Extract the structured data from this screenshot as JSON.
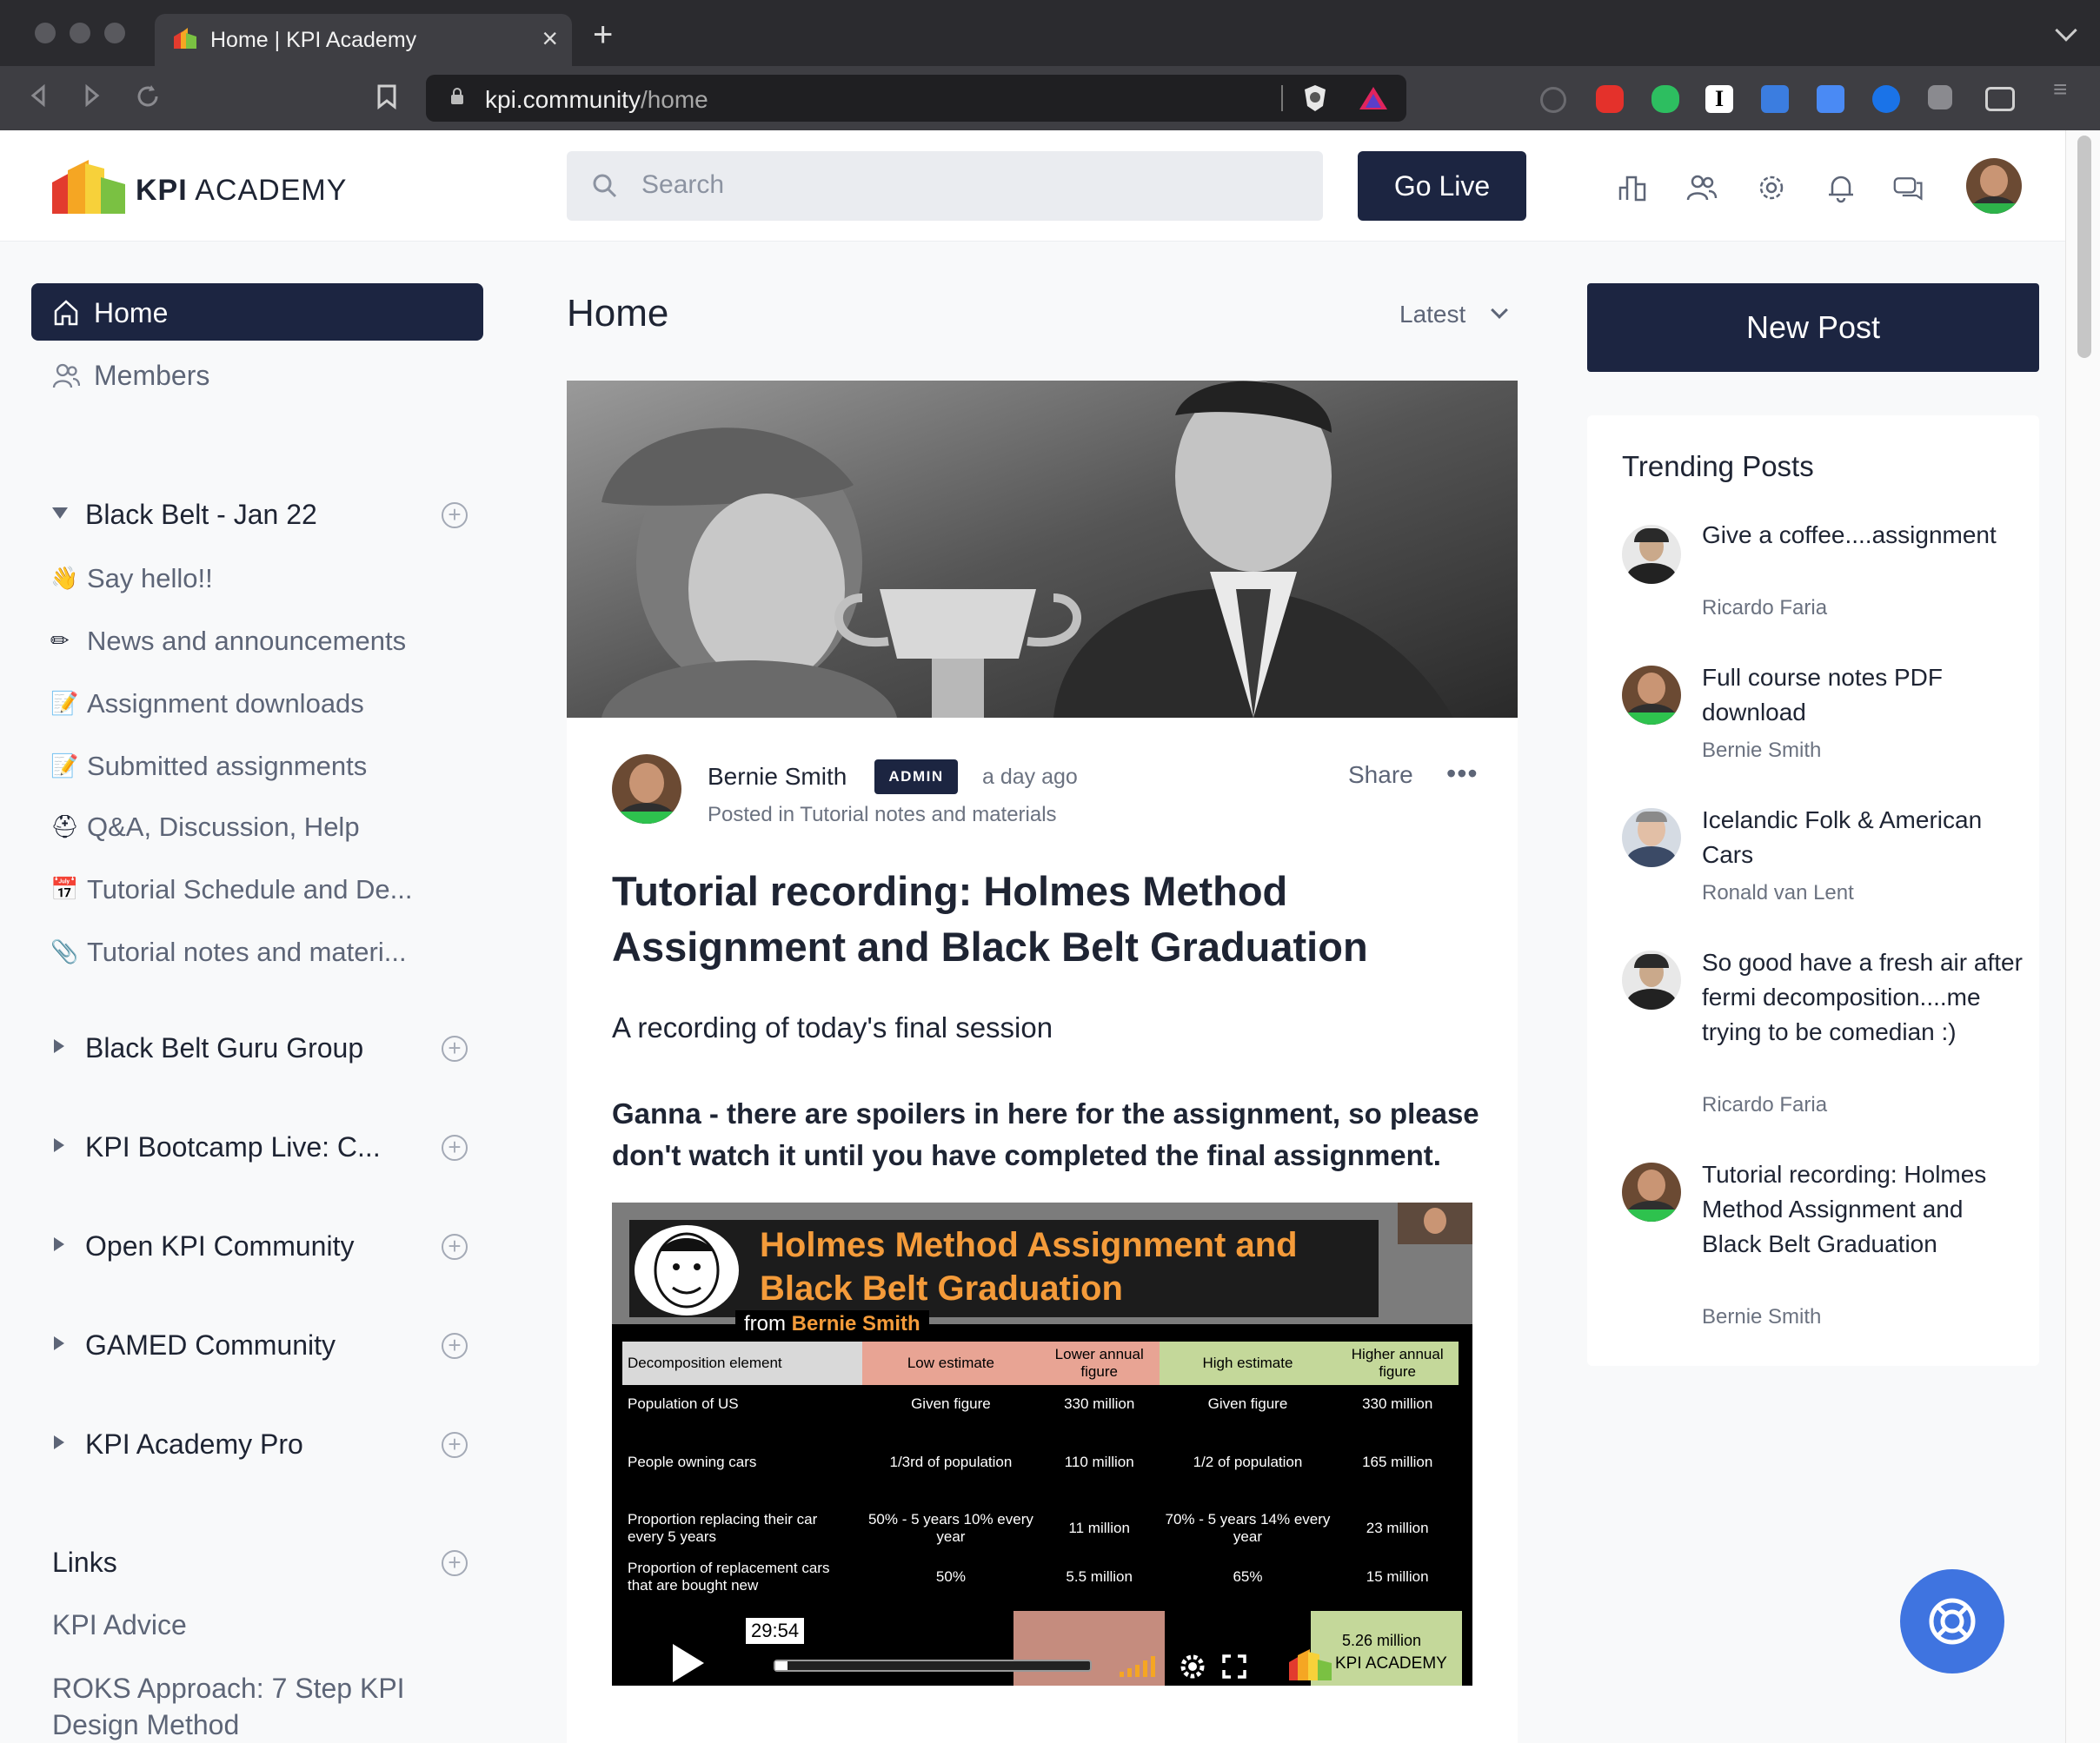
{
  "browser": {
    "tab_title": "Home | KPI Academy",
    "url_domain": "kpi.community",
    "url_path": "/home"
  },
  "header": {
    "logo_bold": "KPI",
    "logo_text": " ACADEMY",
    "search_placeholder": "Search",
    "go_live": "Go Live",
    "icons": [
      "leaderboard-icon",
      "members-icon",
      "settings-icon",
      "bell-icon",
      "chat-icon"
    ]
  },
  "sidebar": {
    "home": "Home",
    "members": "Members",
    "space_groups": [
      {
        "label": "Black Belt - Jan 22",
        "expanded": true
      },
      {
        "label": "Black Belt Guru Group",
        "expanded": false
      },
      {
        "label": "KPI Bootcamp Live: C...",
        "expanded": false
      },
      {
        "label": "Open KPI Community",
        "expanded": false
      },
      {
        "label": "GAMED Community",
        "expanded": false
      },
      {
        "label": "KPI Academy Pro",
        "expanded": false
      }
    ],
    "spaces": [
      {
        "emoji": "👋",
        "label": "Say hello!!"
      },
      {
        "emoji": "✏",
        "label": "News and announcements"
      },
      {
        "emoji": "📝",
        "label": "Assignment downloads"
      },
      {
        "emoji": "📝",
        "label": "Submitted assignments"
      },
      {
        "emoji": "⛑",
        "label": "Q&A, Discussion, Help"
      },
      {
        "emoji": "📅",
        "label": "Tutorial Schedule and De..."
      },
      {
        "emoji": "📎",
        "label": "Tutorial notes and materi..."
      }
    ],
    "links_title": "Links",
    "links": [
      "KPI Advice",
      "ROKS Approach: 7 Step KPI Design Method"
    ]
  },
  "feed": {
    "title": "Home",
    "sort": "Latest",
    "post": {
      "author": "Bernie Smith",
      "badge": "ADMIN",
      "time": "a day ago",
      "posted_in": "Posted in Tutorial notes and materials",
      "share": "Share",
      "more": "•••",
      "title": "Tutorial recording: Holmes Method Assignment and Black Belt Graduation",
      "subtitle": "A recording of today's final session",
      "warning": "Ganna - there are spoilers in here for the assignment, so please don't watch it until you have completed the final assignment.",
      "video": {
        "title_line1": "Holmes Method Assignment and",
        "title_line2": "Black Belt Graduation",
        "from_label": "from ",
        "from_name": "Bernie Smith",
        "time": "29:54",
        "headers": [
          "Decomposition element",
          "Low estimate",
          "Lower annual figure",
          "High estimate",
          "Higher annual figure"
        ],
        "rows": [
          [
            "Population of US",
            "Given figure",
            "330 million",
            "Given figure",
            "330 million"
          ],
          [
            "People owning cars",
            "1/3rd of population",
            "110 million",
            "1/2 of population",
            "165 million"
          ],
          [
            "Proportion replacing their car every 5 years",
            "50% - 5 years 10% every year",
            "11 million",
            "70% - 5 years 14% every year",
            "23 million"
          ],
          [
            "Proportion of replacement cars that are bought new",
            "50%",
            "5.5 million",
            "65%",
            "15 million"
          ]
        ],
        "footer_value": "5.26 million",
        "footer_logo": "KPI ACADEMY",
        "progress": 0.04
      }
    }
  },
  "right": {
    "new_post": "New Post",
    "trending_title": "Trending Posts",
    "trending": [
      {
        "title": "Give a coffee....assignment",
        "author": "Ricardo Faria"
      },
      {
        "title": "Full course notes PDF download",
        "author": "Bernie Smith"
      },
      {
        "title": "Icelandic Folk & American Cars",
        "author": "Ronald van Lent"
      },
      {
        "title": "So good have a fresh air after fermi decomposition....me trying to be comedian :)",
        "author": "Ricardo Faria"
      },
      {
        "title": "Tutorial recording: Holmes Method Assignment and Black Belt Graduation",
        "author": "Bernie Smith"
      }
    ]
  }
}
